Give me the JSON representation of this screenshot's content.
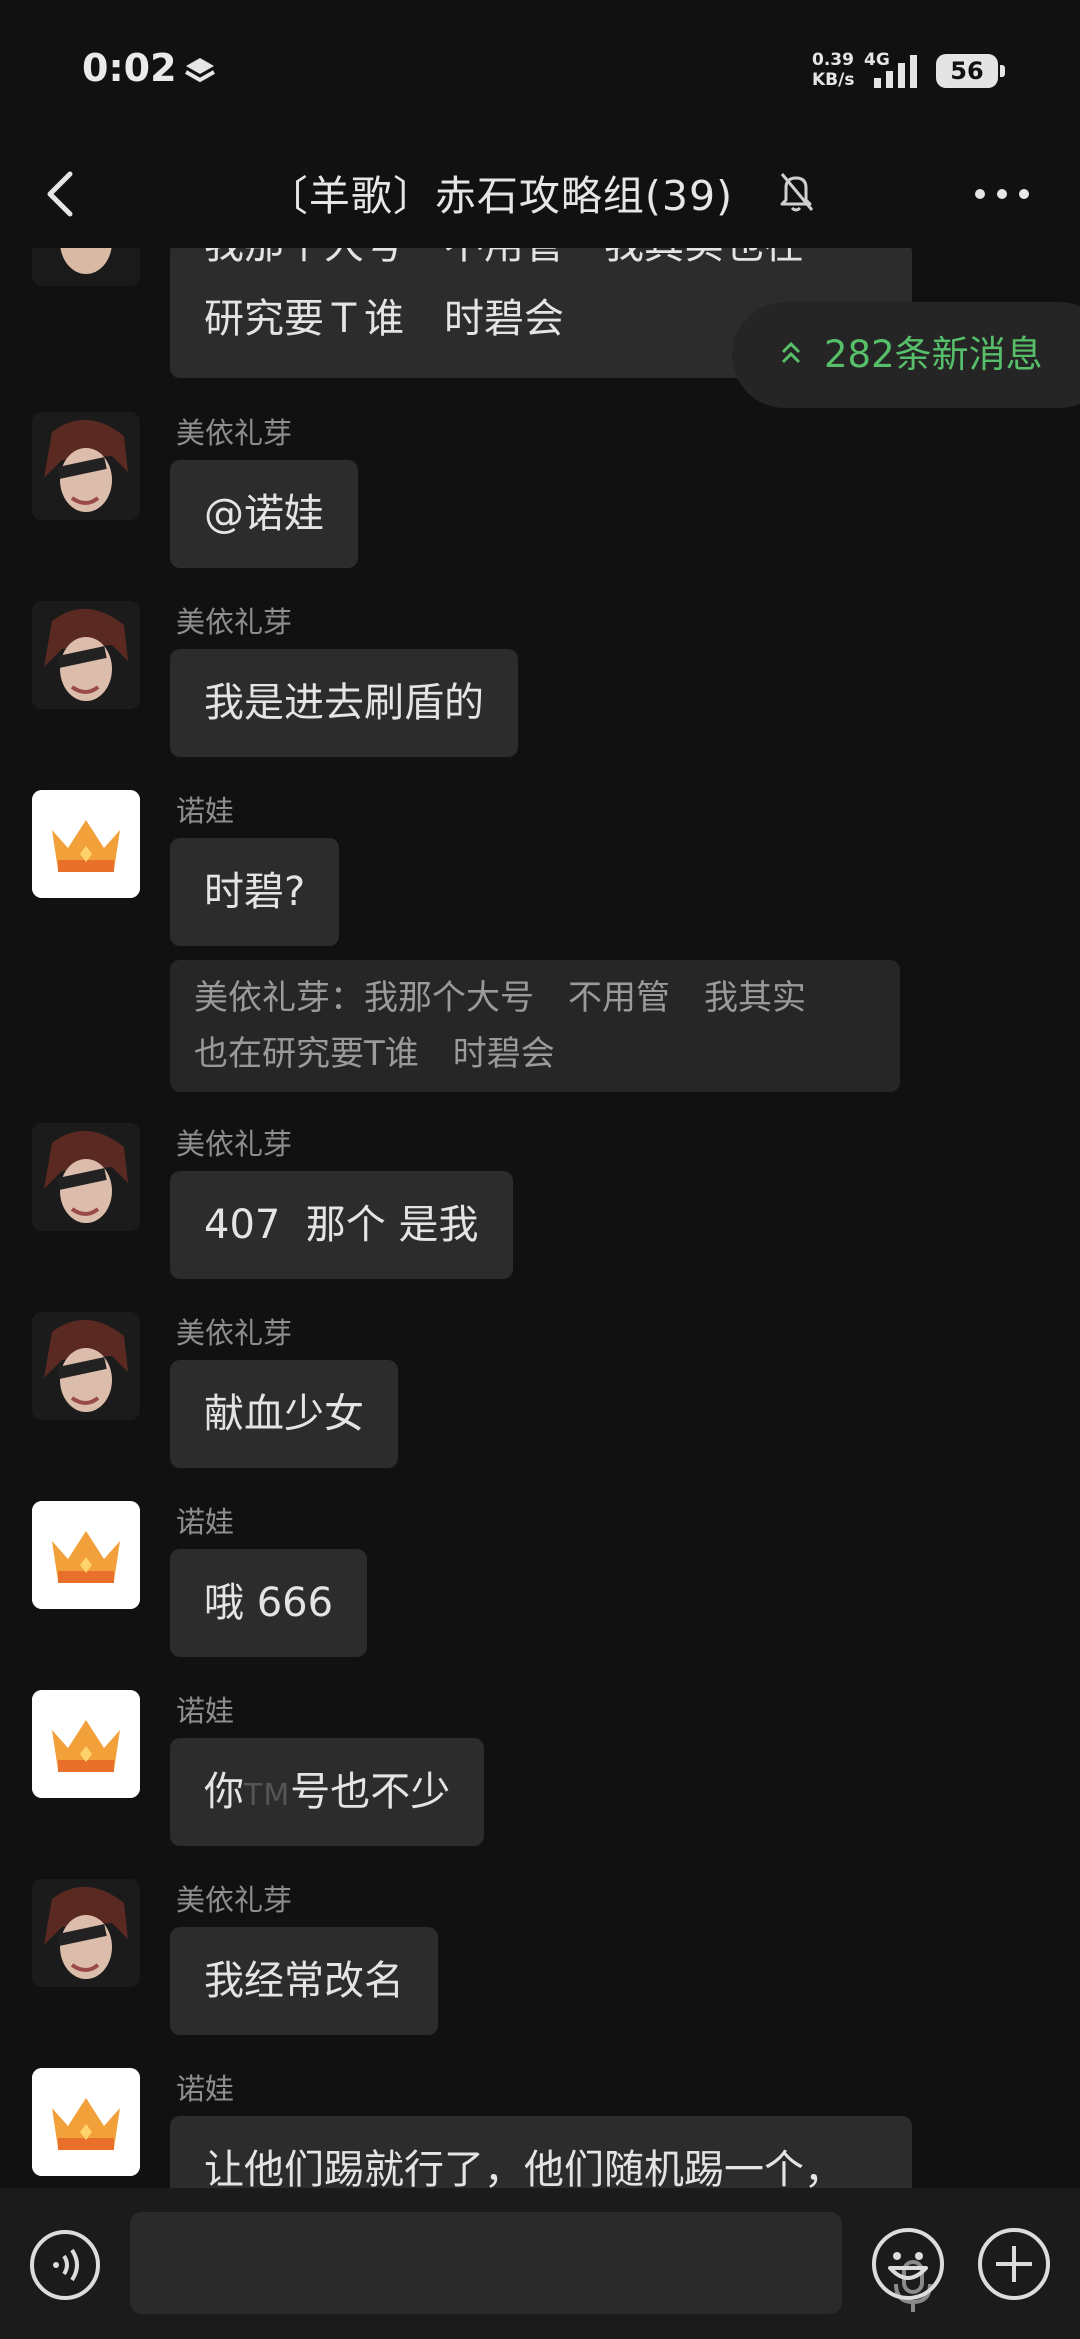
{
  "status": {
    "time": "0:02",
    "net_speed": "0.39",
    "net_unit": "KB/s",
    "net_gen": "4G",
    "battery": "56"
  },
  "header": {
    "title": "〔羊歌〕赤石攻略组(39)"
  },
  "new_messages": {
    "label": "282条新消息"
  },
  "partial_message": {
    "line1": "我那个大号　不用管　我其实也在",
    "line2": "研究要Ｔ谁　时碧会"
  },
  "messages": [
    {
      "sender": "美依礼芽",
      "text": "@诺娃"
    },
    {
      "sender": "美依礼芽",
      "text": "我是进去刷盾的"
    },
    {
      "sender": "诺娃",
      "text": "时碧?",
      "quote_line1": "美依礼芽：我那个大号　不用管　我其实",
      "quote_line2": "也在研究要T谁　时碧会"
    },
    {
      "sender": "美依礼芽",
      "text": "407  那个 是我"
    },
    {
      "sender": "美依礼芽",
      "text": "献血少女"
    },
    {
      "sender": "诺娃",
      "text": "哦 666"
    },
    {
      "sender": "诺娃",
      "text_before": "你",
      "text_tm": "TM",
      "text_after": "号也不少"
    },
    {
      "sender": "美依礼芽",
      "text": "我经常改名"
    },
    {
      "sender": "诺娃",
      "text": "让他们踢就行了，他们随机踢一个，"
    }
  ],
  "colors": {
    "background": "#111111",
    "bubble": "#2c2c2c",
    "accent_green": "#57be6a"
  }
}
